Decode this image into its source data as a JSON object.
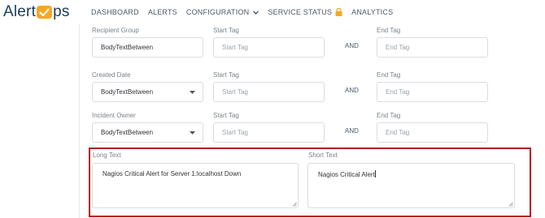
{
  "brand": {
    "name_part1": "Alert",
    "name_part2": "ps",
    "badge_color": "#f6a723"
  },
  "nav": {
    "dashboard": "DASHBOARD",
    "alerts": "ALERTS",
    "configuration": "CONFIGURATION",
    "service_status": "SERVICE STATUS",
    "analytics": "ANALYTICS"
  },
  "form": {
    "and_label": "AND",
    "start_tag_label": "Start Tag",
    "end_tag_label": "End Tag",
    "start_tag_placeholder": "Start Tag",
    "end_tag_placeholder": "End Tag",
    "rows": [
      {
        "label": "Recipient Group",
        "value": "BodyTextBetween"
      },
      {
        "label": "Created Date",
        "value": "BodyTextBetween"
      },
      {
        "label": "Incident Owner",
        "value": "BodyTextBetween"
      }
    ],
    "long_text": {
      "label": "Long Text",
      "value": "Nagios Critical Alert for Server 1:localhost Down"
    },
    "short_text": {
      "label": "Short Text",
      "value": "Nagios Critical Alert"
    }
  },
  "colors": {
    "highlight_border": "#b7191f",
    "nav_text": "#4a5866"
  }
}
